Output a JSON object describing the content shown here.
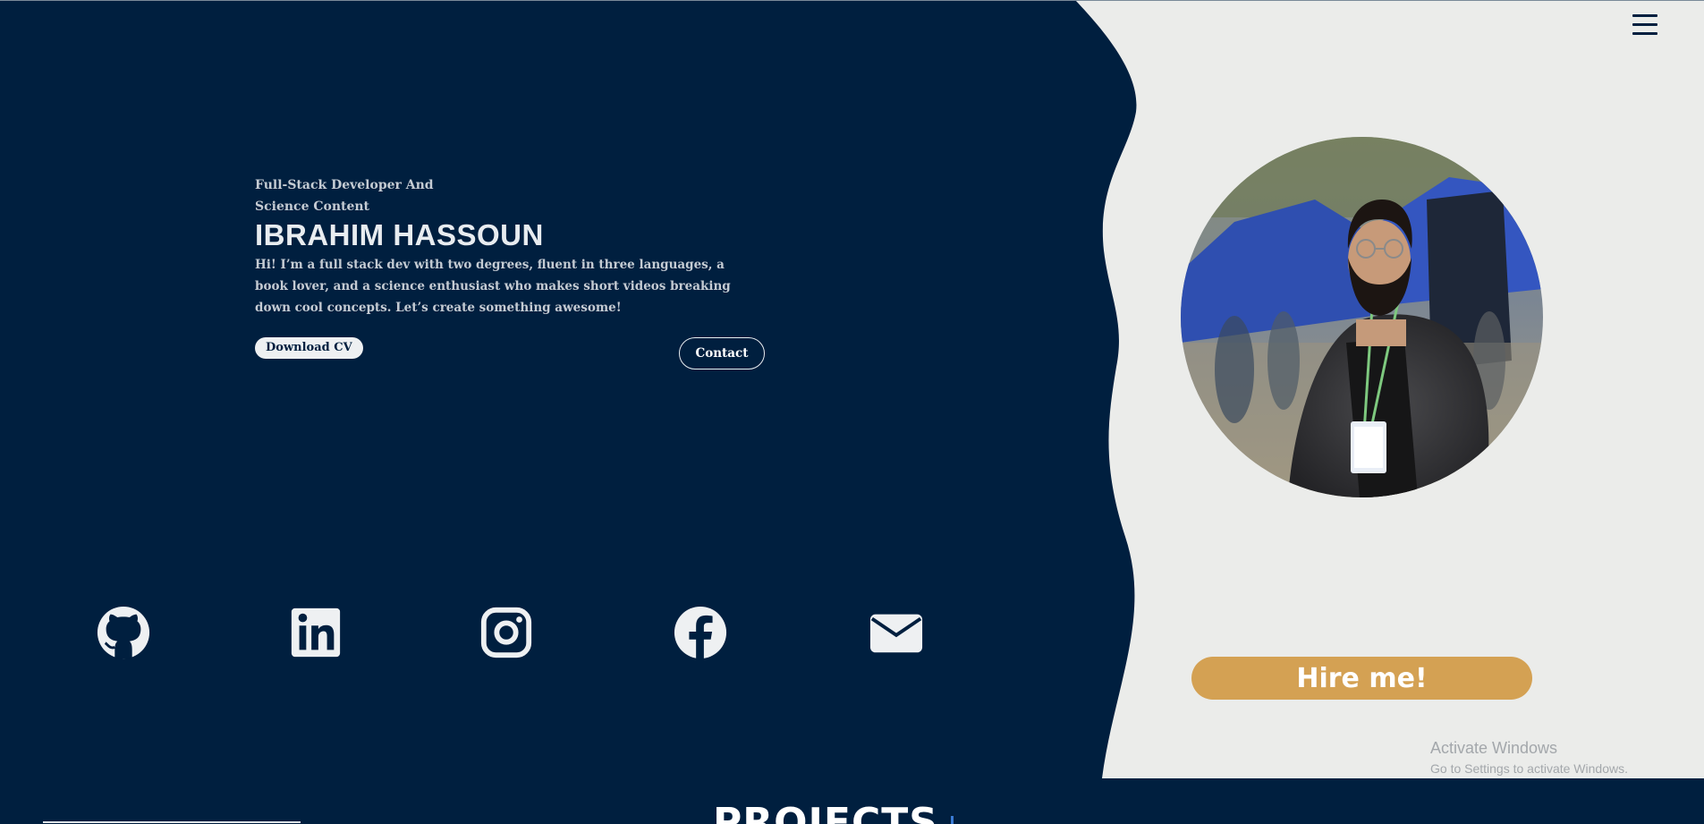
{
  "page": {
    "background": "#001f3f",
    "panel_color": "#ebecea",
    "accent": "#d4a153"
  },
  "header": {
    "menu_icon": "hamburger-menu-icon"
  },
  "intro": {
    "tagline": "Full-Stack Developer And Science Content",
    "name": "IBRAHIM HASSOUN",
    "bio": "Hi! I’m a full stack dev with two degrees, fluent in three languages, a book lover, and a science enthusiast who makes short videos breaking down cool concepts. Let’s create something awesome!"
  },
  "buttons": {
    "download_cv": "Download CV",
    "contact": "Contact",
    "hire_me": "Hire me!"
  },
  "social": [
    {
      "icon": "github-icon"
    },
    {
      "icon": "linkedin-icon"
    },
    {
      "icon": "instagram-icon"
    },
    {
      "icon": "facebook-icon"
    },
    {
      "icon": "email-icon"
    }
  ],
  "portrait": {
    "icon": "profile-photo"
  },
  "watermark": {
    "title": "Activate Windows",
    "subtitle": "Go to Settings to activate Windows."
  },
  "projects": {
    "heading": "PROJECTS"
  }
}
